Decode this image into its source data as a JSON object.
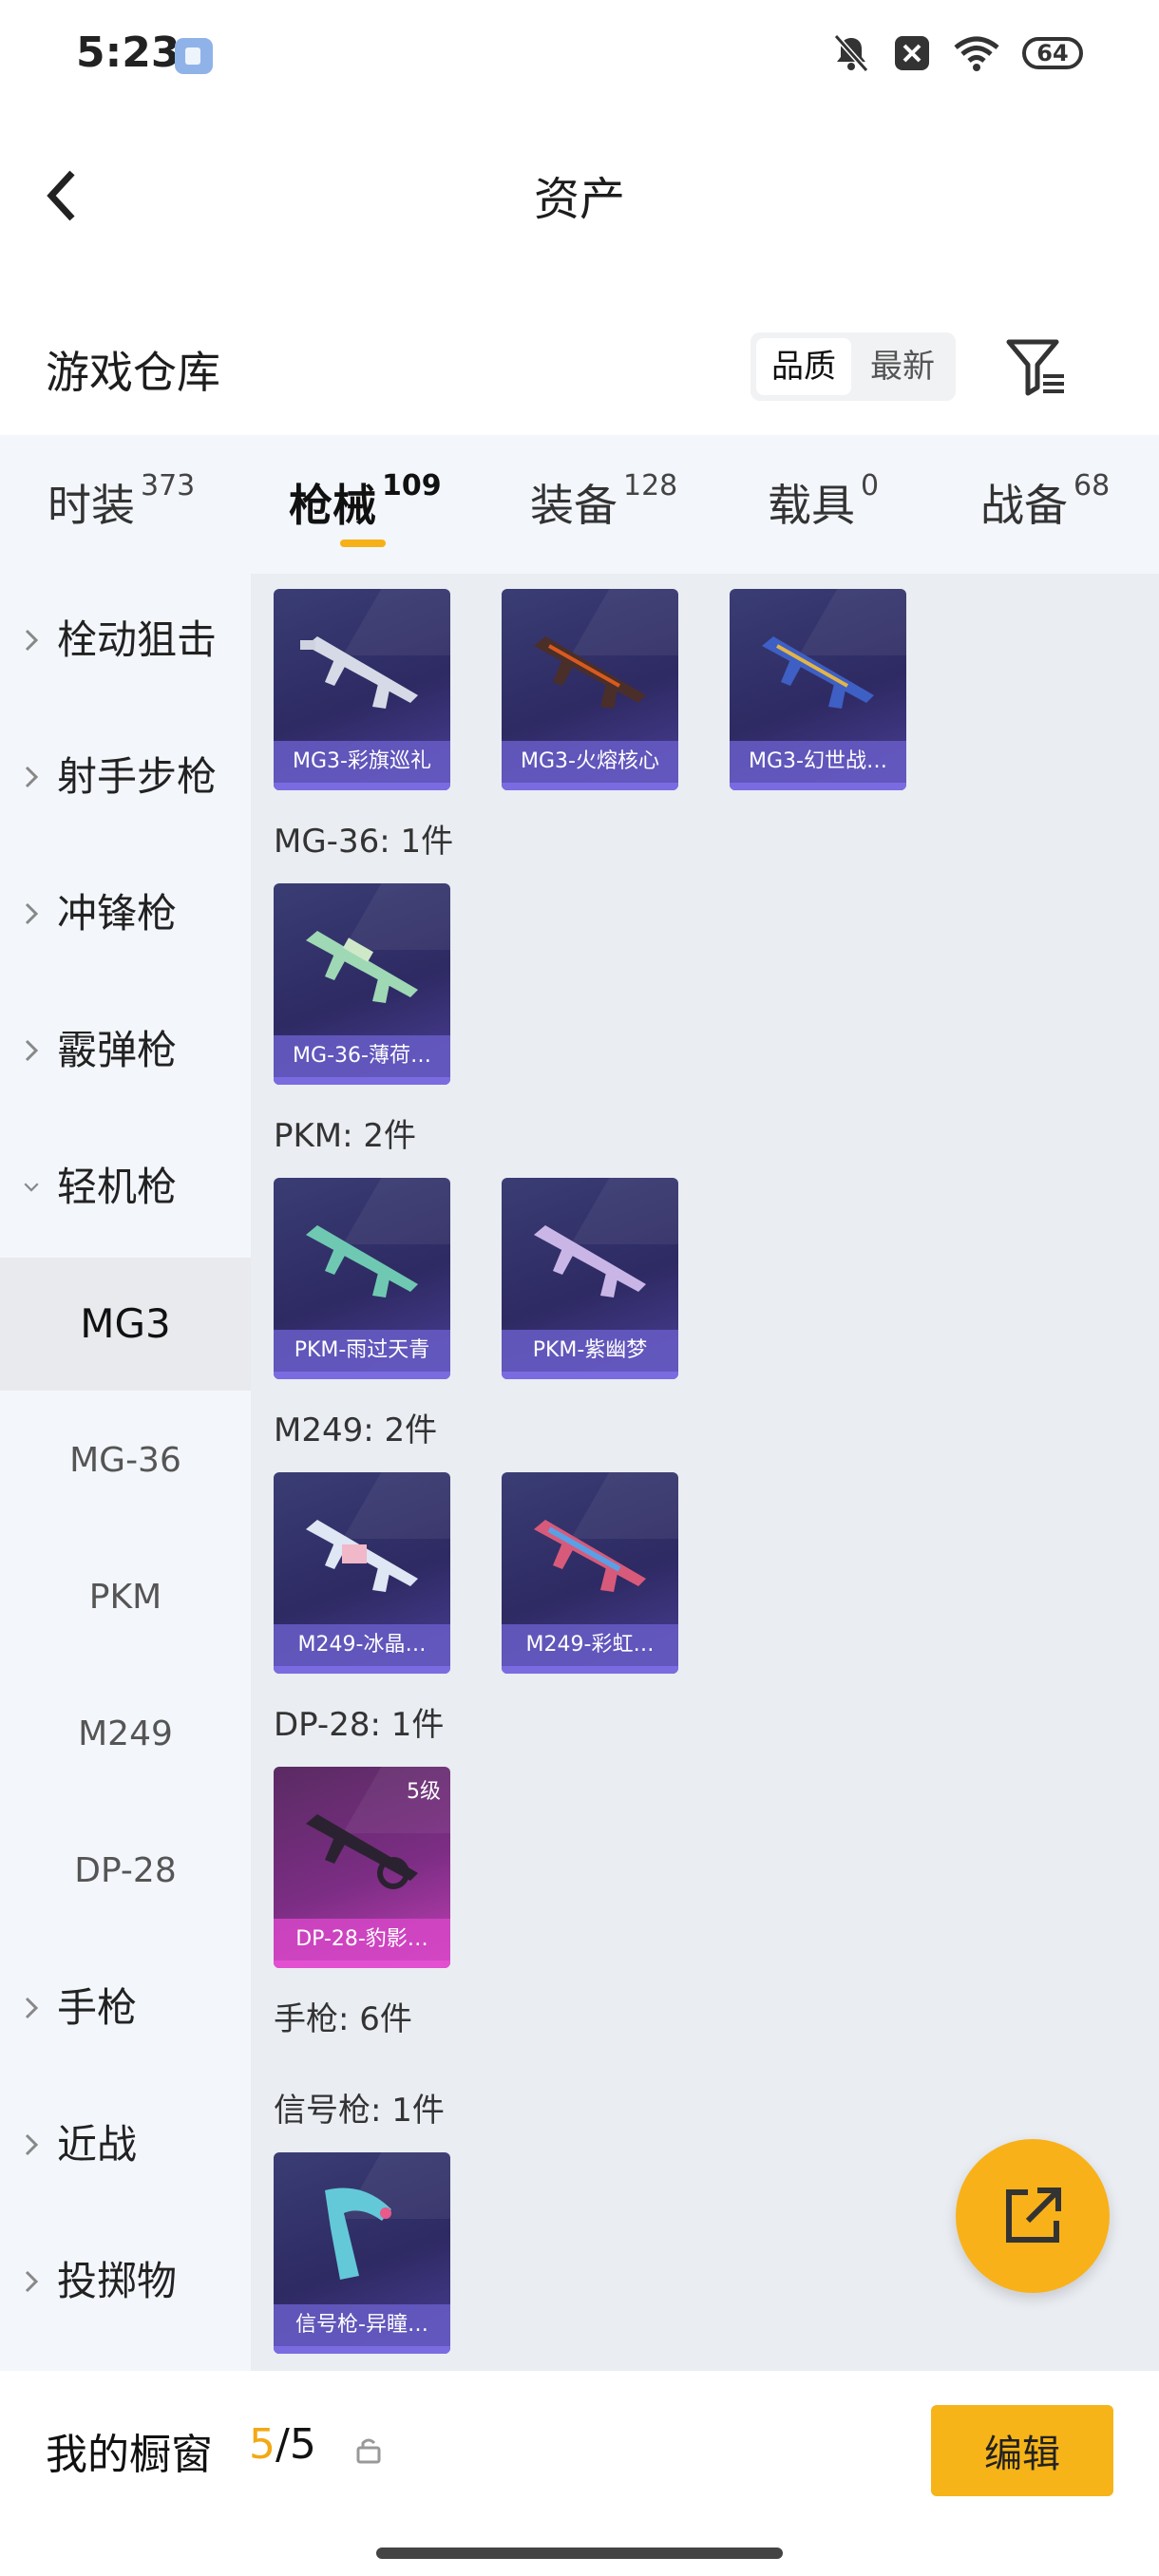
{
  "status_bar": {
    "time": "5:23",
    "battery": "64"
  },
  "header": {
    "title": "资产"
  },
  "repository": {
    "title": "游戏仓库",
    "sort_quality": "品质",
    "sort_newest": "最新"
  },
  "tabs": [
    {
      "label": "时装",
      "count": "373"
    },
    {
      "label": "枪械",
      "count": "109"
    },
    {
      "label": "装备",
      "count": "128"
    },
    {
      "label": "载具",
      "count": "0"
    },
    {
      "label": "战备",
      "count": "68"
    }
  ],
  "sidebar": {
    "categories_top": [
      "栓动狙击",
      "射手步枪",
      "冲锋枪",
      "霰弹枪"
    ],
    "expanded_category": "轻机枪",
    "subcategories": [
      "MG3",
      "MG-36",
      "PKM",
      "M249",
      "DP-28"
    ],
    "categories_bottom": [
      "手枪",
      "近战",
      "投掷物"
    ]
  },
  "content": {
    "mg3_items": [
      "MG3-彩旗巡礼",
      "MG3-火熔核心",
      "MG3-幻世战…"
    ],
    "group_mg36": "MG-36: 1件",
    "mg36_items": [
      "MG-36-薄荷…"
    ],
    "group_pkm": "PKM: 2件",
    "pkm_items": [
      "PKM-雨过天青",
      "PKM-紫幽梦"
    ],
    "group_m249": "M249: 2件",
    "m249_items": [
      "M249-冰晶…",
      "M249-彩虹…"
    ],
    "group_dp28": "DP-28: 1件",
    "dp28_items": [
      "DP-28-豹影…"
    ],
    "dp28_level": "5级",
    "group_pistol": "手枪: 6件",
    "group_flare": "信号枪: 1件",
    "flare_items": [
      "信号枪-异瞳…"
    ]
  },
  "bottom": {
    "label": "我的橱窗",
    "count_current": "5",
    "count_total": "/5",
    "edit_button": "编辑"
  },
  "colors": {
    "accent": "#f7b418",
    "card_blue": "#2e2a63",
    "card_purple": "#7c2d84",
    "label_bar": "#675bc4"
  }
}
